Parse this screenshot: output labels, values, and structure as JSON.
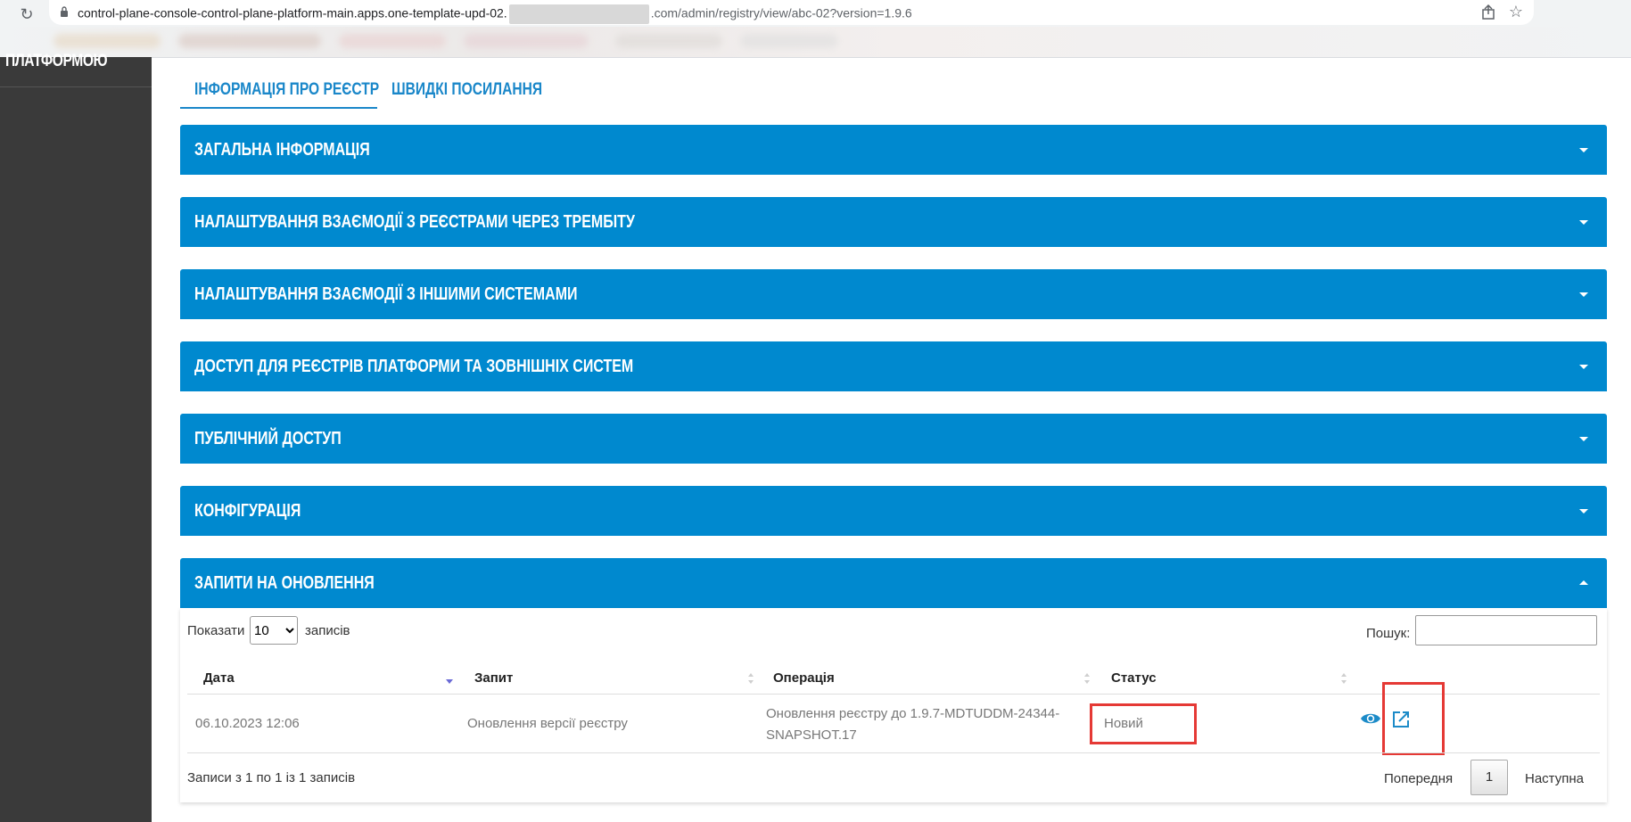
{
  "browser": {
    "url_host": "control-plane-console-control-plane-platform-main.apps.one-template-upd-02.",
    "url_path": ".com/admin/registry/view/abc-02?version=1.9.6"
  },
  "sidebar": {
    "title": "ПЛАТФОРМОЮ"
  },
  "tabs": [
    {
      "label": "ІНФОРМАЦІЯ ПРО РЕЄСТР",
      "active": true
    },
    {
      "label": "ШВИДКІ ПОСИЛАННЯ",
      "active": false
    }
  ],
  "panels": [
    {
      "title": "ЗАГАЛЬНА ІНФОРМАЦІЯ",
      "expanded": false
    },
    {
      "title": "НАЛАШТУВАННЯ ВЗАЄМОДІЇ З РЕЄСТРАМИ ЧЕРЕЗ ТРЕМБІТУ",
      "expanded": false
    },
    {
      "title": "НАЛАШТУВАННЯ ВЗАЄМОДІЇ З ІНШИМИ СИСТЕМАМИ",
      "expanded": false
    },
    {
      "title": "ДОСТУП ДЛЯ РЕЄСТРІВ ПЛАТФОРМИ ТА ЗОВНІШНІХ СИСТЕМ",
      "expanded": false
    },
    {
      "title": "ПУБЛІЧНИЙ ДОСТУП",
      "expanded": false
    },
    {
      "title": "КОНФІГУРАЦІЯ",
      "expanded": false
    },
    {
      "title": "ЗАПИТИ НА ОНОВЛЕННЯ",
      "expanded": true
    }
  ],
  "table": {
    "show_label": "Показати",
    "page_size": "10",
    "show_suffix": "записів",
    "search_label": "Пошук:",
    "columns": [
      "Дата",
      "Запит",
      "Операція",
      "Статус"
    ],
    "rows": [
      {
        "date": "06.10.2023 12:06",
        "request": "Оновлення версії реєстру",
        "operation_line1": "Оновлення реєстру до 1.9.7-MDTUDDM-24344-",
        "operation_line2": "SNAPSHOT.17",
        "status": "Новий"
      }
    ],
    "info": "Записи з 1 по 1 із 1 записів",
    "prev": "Попередня",
    "page": "1",
    "next": "Наступна"
  },
  "colors": {
    "accent": "#0089cf",
    "sidebar": "#3a3a3a",
    "highlight": "#e53935"
  }
}
